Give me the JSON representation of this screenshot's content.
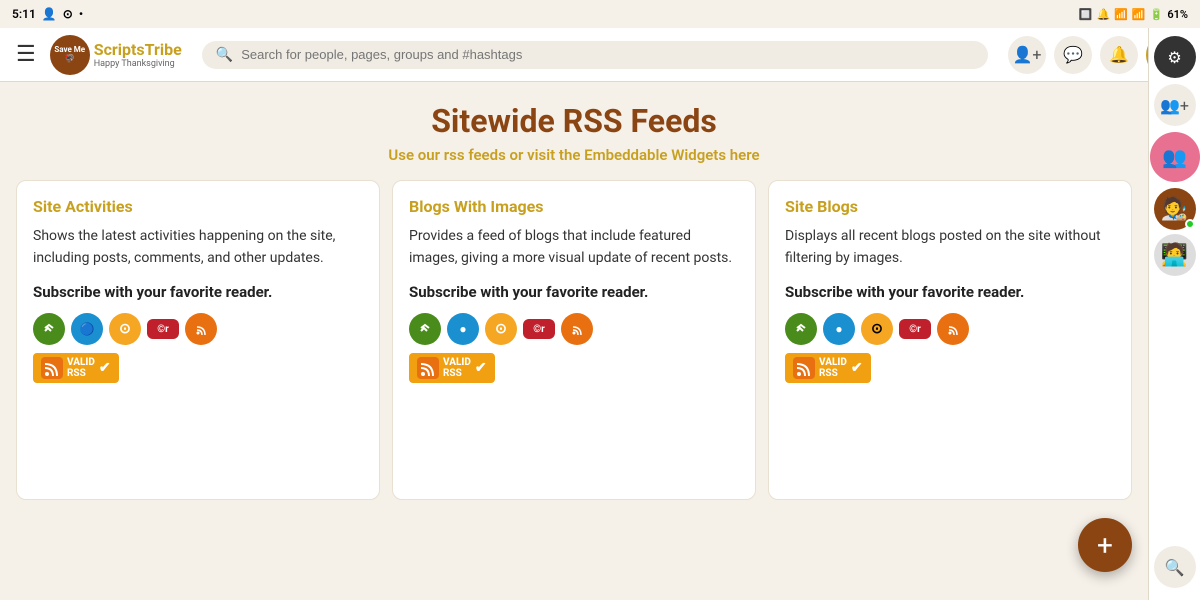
{
  "statusBar": {
    "time": "5:11",
    "battery": "61%"
  },
  "nav": {
    "searchPlaceholder": "Search for people, pages, groups and #hashtags",
    "logoTextPart1": "Scripts",
    "logoTextPart2": "Tribe",
    "logoSub": "Happy Thanksgiving"
  },
  "page": {
    "title": "Sitewide RSS Feeds",
    "subtitle": "Use our rss feeds or visit the Embeddable Widgets here"
  },
  "cards": [
    {
      "id": "site-activities",
      "title": "Site Activities",
      "description": "Shows the latest activities happening on the site, including posts, comments, and other updates.",
      "subscribeText": "Subscribe with your favorite reader."
    },
    {
      "id": "blogs-with-images",
      "title": "Blogs With Images",
      "description": "Provides a feed of blogs that include featured images, giving a more visual update of recent posts.",
      "subscribeText": "Subscribe with your favorite reader."
    },
    {
      "id": "site-blogs",
      "title": "Site Blogs",
      "description": "Displays all recent blogs posted on the site without filtering by images.",
      "subscribeText": "Subscribe with your favorite reader."
    }
  ],
  "validRss": {
    "label": "VALID",
    "sublabel": "RSS"
  },
  "fab": {
    "label": "+"
  }
}
